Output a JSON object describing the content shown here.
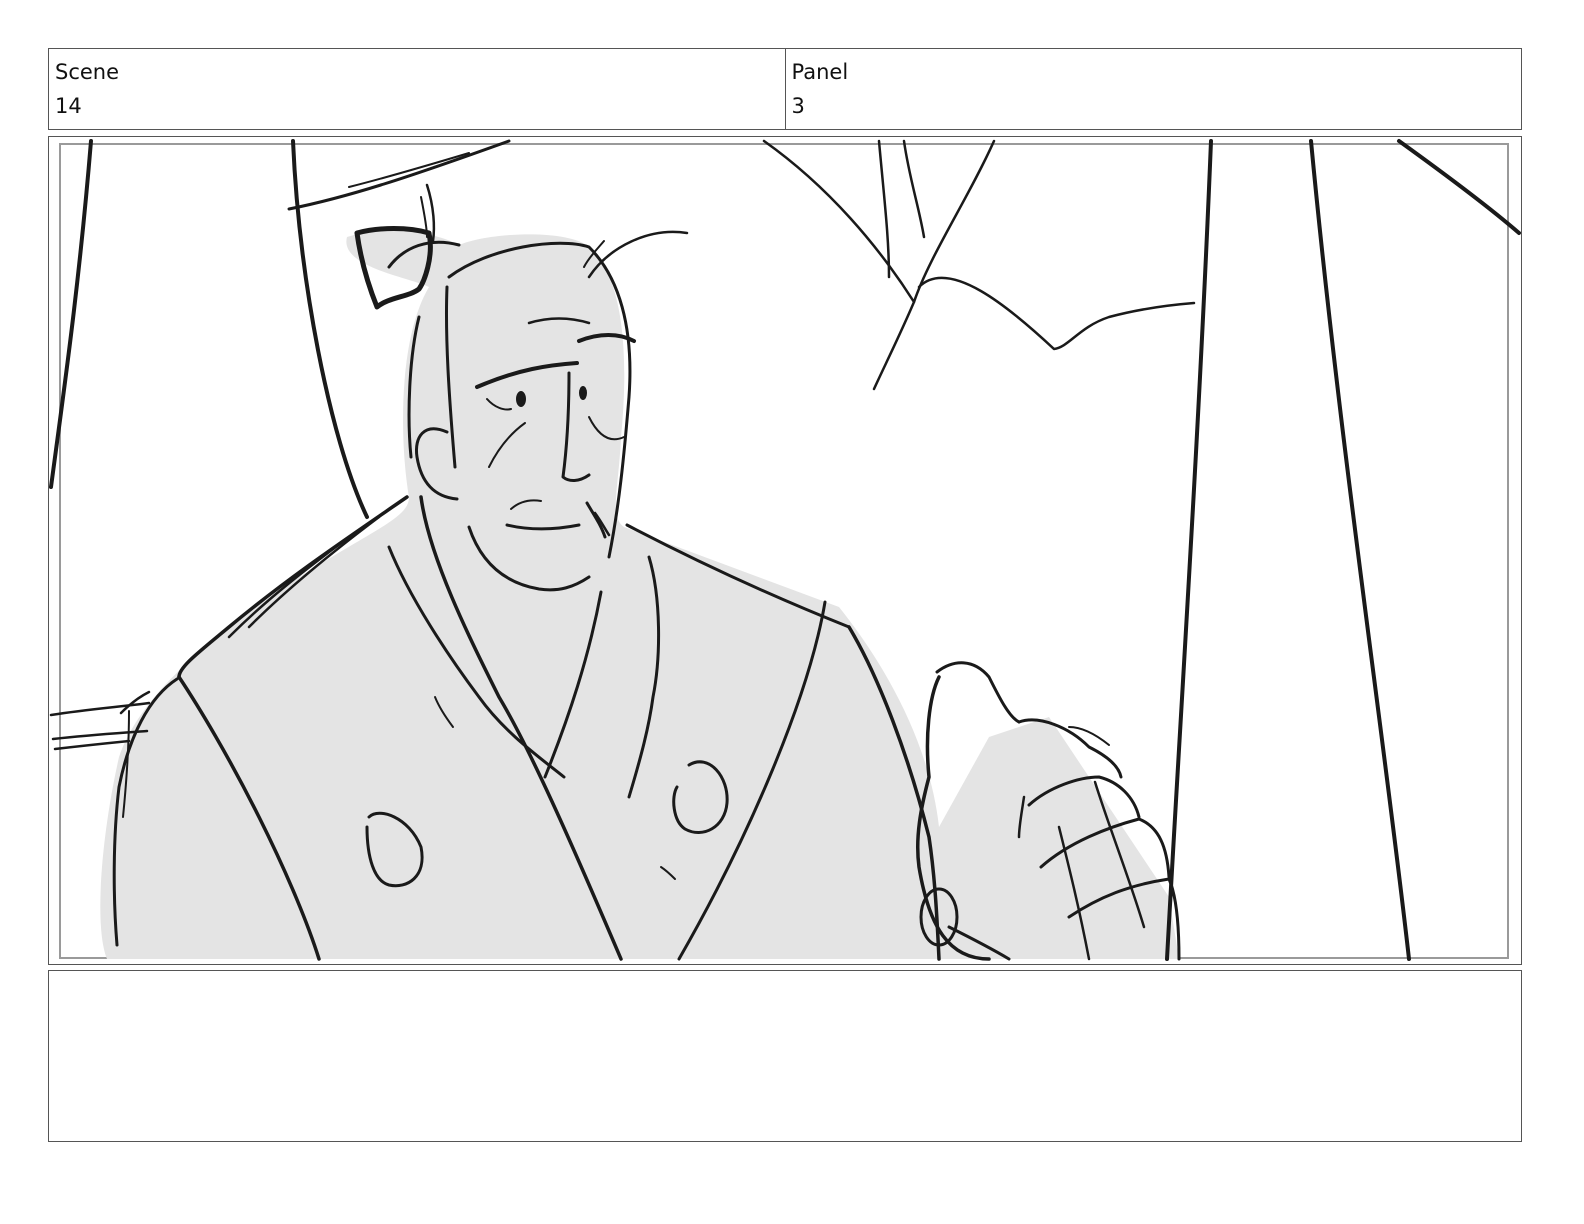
{
  "header": {
    "scene_label": "Scene",
    "scene_value": "14",
    "panel_label": "Panel",
    "panel_value": "3"
  },
  "notes": "",
  "colors": {
    "ink": "#1a1a1a",
    "tone": "#e4e4e4",
    "border": "#555555"
  }
}
